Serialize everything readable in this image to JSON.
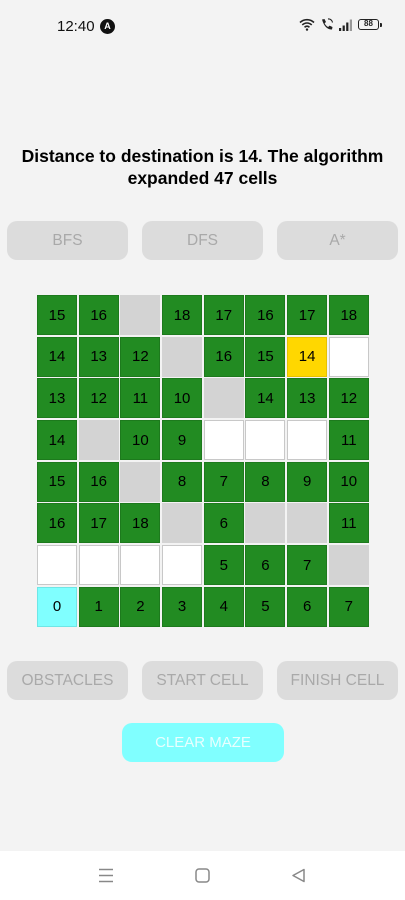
{
  "status_bar": {
    "time": "12:40",
    "app_icon": "A",
    "battery": "88",
    "icons": [
      "wifi-icon",
      "wifi-call-icon",
      "signal-icon",
      "battery-icon"
    ]
  },
  "headline": "Distance to destination is 14. The algorithm expanded 47 cells",
  "algorithm_buttons": [
    "BFS",
    "DFS",
    "A*"
  ],
  "mode_buttons": [
    "OBSTACLES",
    "START CELL",
    "FINISH CELL"
  ],
  "clear_button": "CLEAR MAZE",
  "colors": {
    "path": "#228b22",
    "wall": "#d3d3d3",
    "empty": "#ffffff",
    "start": "#80ffff",
    "finish": "#ffd700",
    "button_bg": "#dcdcdc",
    "button_text": "#a9a9a9"
  },
  "maze": [
    [
      {
        "t": "path",
        "v": "15"
      },
      {
        "t": "path",
        "v": "16"
      },
      {
        "t": "wall",
        "v": ""
      },
      {
        "t": "path",
        "v": "18"
      },
      {
        "t": "path",
        "v": "17"
      },
      {
        "t": "path",
        "v": "16"
      },
      {
        "t": "path",
        "v": "17"
      },
      {
        "t": "path",
        "v": "18"
      }
    ],
    [
      {
        "t": "path",
        "v": "14"
      },
      {
        "t": "path",
        "v": "13"
      },
      {
        "t": "path",
        "v": "12"
      },
      {
        "t": "wall",
        "v": ""
      },
      {
        "t": "path",
        "v": "16"
      },
      {
        "t": "path",
        "v": "15"
      },
      {
        "t": "finish",
        "v": "14"
      },
      {
        "t": "empty",
        "v": ""
      }
    ],
    [
      {
        "t": "path",
        "v": "13"
      },
      {
        "t": "path",
        "v": "12"
      },
      {
        "t": "path",
        "v": "11"
      },
      {
        "t": "path",
        "v": "10"
      },
      {
        "t": "wall",
        "v": ""
      },
      {
        "t": "path",
        "v": "14"
      },
      {
        "t": "path",
        "v": "13"
      },
      {
        "t": "path",
        "v": "12"
      }
    ],
    [
      {
        "t": "path",
        "v": "14"
      },
      {
        "t": "wall",
        "v": ""
      },
      {
        "t": "path",
        "v": "10"
      },
      {
        "t": "path",
        "v": "9"
      },
      {
        "t": "empty",
        "v": ""
      },
      {
        "t": "empty",
        "v": ""
      },
      {
        "t": "empty",
        "v": ""
      },
      {
        "t": "path",
        "v": "11"
      }
    ],
    [
      {
        "t": "path",
        "v": "15"
      },
      {
        "t": "path",
        "v": "16"
      },
      {
        "t": "wall",
        "v": ""
      },
      {
        "t": "path",
        "v": "8"
      },
      {
        "t": "path",
        "v": "7"
      },
      {
        "t": "path",
        "v": "8"
      },
      {
        "t": "path",
        "v": "9"
      },
      {
        "t": "path",
        "v": "10"
      }
    ],
    [
      {
        "t": "path",
        "v": "16"
      },
      {
        "t": "path",
        "v": "17"
      },
      {
        "t": "path",
        "v": "18"
      },
      {
        "t": "wall",
        "v": ""
      },
      {
        "t": "path",
        "v": "6"
      },
      {
        "t": "wall",
        "v": ""
      },
      {
        "t": "wall",
        "v": ""
      },
      {
        "t": "path",
        "v": "11"
      }
    ],
    [
      {
        "t": "empty",
        "v": ""
      },
      {
        "t": "empty",
        "v": ""
      },
      {
        "t": "empty",
        "v": ""
      },
      {
        "t": "empty",
        "v": ""
      },
      {
        "t": "path",
        "v": "5"
      },
      {
        "t": "path",
        "v": "6"
      },
      {
        "t": "path",
        "v": "7"
      },
      {
        "t": "wall",
        "v": ""
      }
    ],
    [
      {
        "t": "start",
        "v": "0"
      },
      {
        "t": "path",
        "v": "1"
      },
      {
        "t": "path",
        "v": "2"
      },
      {
        "t": "path",
        "v": "3"
      },
      {
        "t": "path",
        "v": "4"
      },
      {
        "t": "path",
        "v": "5"
      },
      {
        "t": "path",
        "v": "6"
      },
      {
        "t": "path",
        "v": "7"
      }
    ]
  ],
  "nav_bar": [
    "menu-icon",
    "home-icon",
    "back-icon"
  ]
}
